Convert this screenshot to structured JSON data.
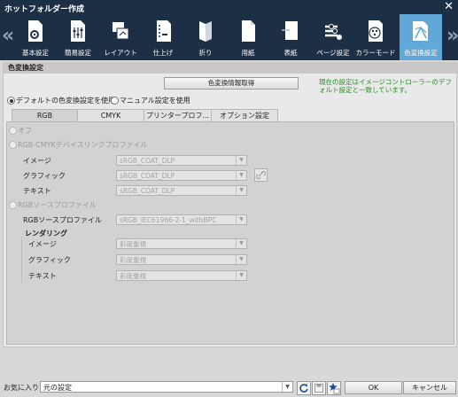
{
  "window": {
    "title": "ホットフォルダー作成",
    "close": "✕"
  },
  "toolbar": {
    "items": [
      {
        "label": "基本設定",
        "icon": "gear-document-icon"
      },
      {
        "label": "簡易設定",
        "icon": "sliders-icon"
      },
      {
        "label": "レイアウト",
        "icon": "layout-icon"
      },
      {
        "label": "仕上げ",
        "icon": "finishing-icon"
      },
      {
        "label": "折り",
        "icon": "fold-icon"
      },
      {
        "label": "用紙",
        "icon": "paper-icon"
      },
      {
        "label": "表紙",
        "icon": "cover-icon"
      },
      {
        "label": "ページ設定",
        "icon": "page-settings-icon"
      },
      {
        "label": "カラーモード",
        "icon": "color-mode-icon"
      },
      {
        "label": "色変換設定",
        "icon": "color-conversion-icon",
        "active": true
      }
    ],
    "prev": "«",
    "next": "»"
  },
  "section": {
    "title": "色変換設定",
    "get_info_button": "色変換情報取得",
    "note": "現在の設定はイメージコントローラーのデフォルト設定と一致しています。",
    "radio_default": "デフォルトの色変換設定を使用",
    "radio_manual": "マニュアル設定を使用"
  },
  "tabs": [
    "RGB",
    "CMYK",
    "プリンタープロフ...",
    "オプション設定"
  ],
  "rgb": {
    "off": "オフ",
    "devlink_title": "RGB-CMYKデバイスリンクプロファイル",
    "devlink_rows": [
      {
        "label": "イメージ",
        "value": "sRGB_COAT_DLP"
      },
      {
        "label": "グラフィック",
        "value": "sRGB_COAT_DLP"
      },
      {
        "label": "テキスト",
        "value": "sRGB_COAT_DLP"
      }
    ],
    "source_title": "RGBソースプロファイル",
    "source_label": "RGBソースプロファイル",
    "source_value": "sRGB_IEC61966-2-1_withBPC",
    "rendering_title": "レンダリング",
    "rendering_rows": [
      {
        "label": "イメージ",
        "value": "彩度重視"
      },
      {
        "label": "グラフィック",
        "value": "彩度重視"
      },
      {
        "label": "テキスト",
        "value": "彩度重視"
      }
    ]
  },
  "footer": {
    "fav_label": "お気に入り",
    "fav_value": "元の設定",
    "ok": "OK",
    "cancel": "キャンセル"
  }
}
